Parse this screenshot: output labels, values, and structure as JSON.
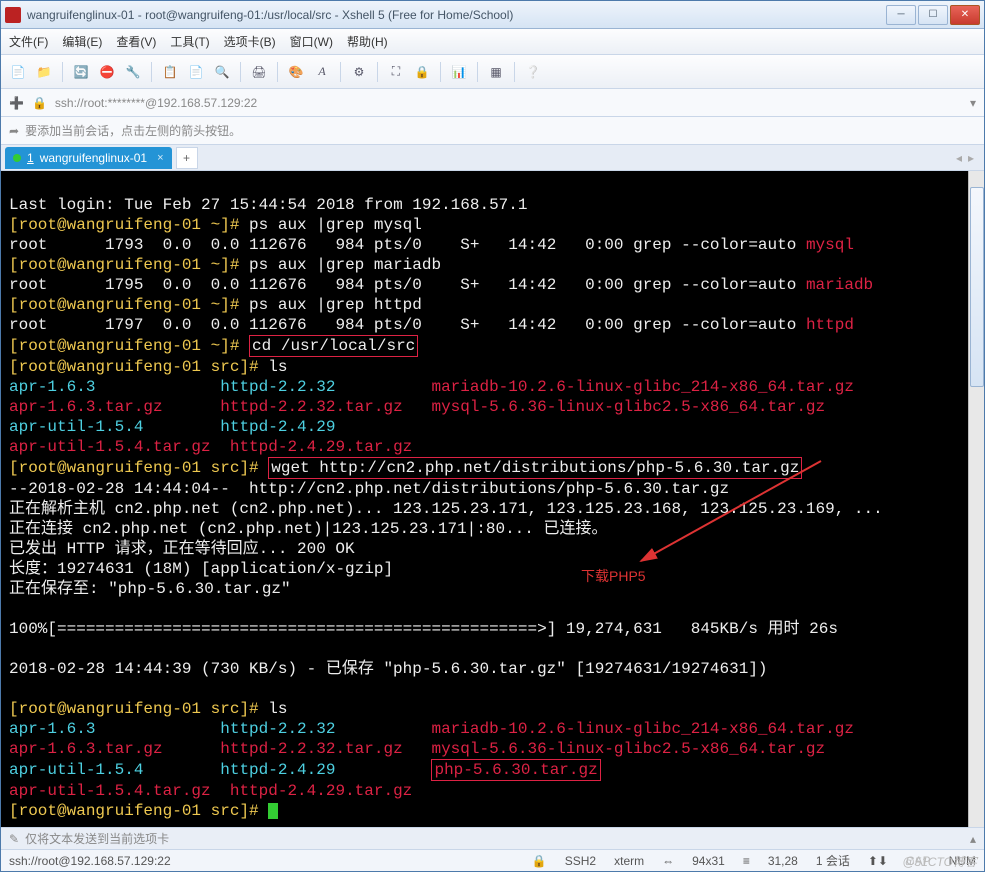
{
  "window": {
    "title": "wangruifenglinux-01 - root@wangruifeng-01:/usr/local/src - Xshell 5 (Free for Home/School)"
  },
  "menu": {
    "file": "文件(F)",
    "edit": "编辑(E)",
    "view": "查看(V)",
    "tools": "工具(T)",
    "tab": "选项卡(B)",
    "window": "窗口(W)",
    "help": "帮助(H)"
  },
  "addr": {
    "text": "ssh://root:********@192.168.57.129:22"
  },
  "hint": {
    "text": "要添加当前会话，点击左侧的箭头按钮。"
  },
  "tab": {
    "num": "1",
    "label": "wangruifenglinux-01"
  },
  "term": {
    "l1": "Last login: Tue Feb 27 15:44:54 2018 from 192.168.57.1",
    "p1": "[root@wangruifeng-01 ~]# ",
    "c1": "ps aux |grep mysql",
    "l2a": "root      1793  0.0  0.0 112676   984 pts/0    S+   14:42   0:00 grep --color=auto ",
    "l2b": "mysql",
    "c2": "ps aux |grep mariadb",
    "l3a": "root      1795  0.0  0.0 112676   984 pts/0    S+   14:42   0:00 grep --color=auto ",
    "l3b": "mariadb",
    "c3": "ps aux |grep httpd",
    "l4a": "root      1797  0.0  0.0 112676   984 pts/0    S+   14:42   0:00 grep --color=auto ",
    "l4b": "httpd",
    "c4": "cd /usr/local/src",
    "p2": "[root@wangruifeng-01 src]# ",
    "c5": "ls",
    "f1": "apr-1.6.3           ",
    "f2": "httpd-2.2.32        ",
    "f3": "mariadb-10.2.6-linux-glibc_214-x86_64.tar.gz",
    "f4": "apr-1.6.3.tar.gz    ",
    "f5": "httpd-2.2.32.tar.gz ",
    "f6": "mysql-5.6.36-linux-glibc2.5-x86_64.tar.gz",
    "f7": "apr-util-1.5.4      ",
    "f8": "httpd-2.4.29",
    "f9": "apr-util-1.5.4.tar.gz ",
    "f10": "httpd-2.4.29.tar.gz",
    "c6": "wget http://cn2.php.net/distributions/php-5.6.30.tar.gz",
    "w1": "--2018-02-28 14:44:04--  http://cn2.php.net/distributions/php-5.6.30.tar.gz",
    "w2": "正在解析主机 cn2.php.net (cn2.php.net)... 123.125.23.171, 123.125.23.168, 123.125.23.169, ...",
    "w3": "正在连接 cn2.php.net (cn2.php.net)|123.125.23.171|:80... 已连接。",
    "w4": "已发出 HTTP 请求，正在等待回应... 200 OK",
    "w5": "长度：19274631 (18M) [application/x-gzip]",
    "w6": "正在保存至: \"php-5.6.30.tar.gz\"",
    "prog": "100%[==================================================>] 19,274,631   845KB/s 用时 26s",
    "w7": "2018-02-28 14:44:39 (730 KB/s) - 已保存 \"php-5.6.30.tar.gz\" [19274631/19274631])",
    "f11": "php-5.6.30.tar.gz",
    "annot": "下载PHP5"
  },
  "send": {
    "text": "仅将文本发送到当前选项卡"
  },
  "status": {
    "left": "ssh://root@192.168.57.129:22",
    "ssh": "SSH2",
    "term": "xterm",
    "size": "94x31",
    "pos": "31,28",
    "sess": "1 会话",
    "cap": "CAP",
    "num": "NUM"
  },
  "watermark": "@51CTO博客"
}
